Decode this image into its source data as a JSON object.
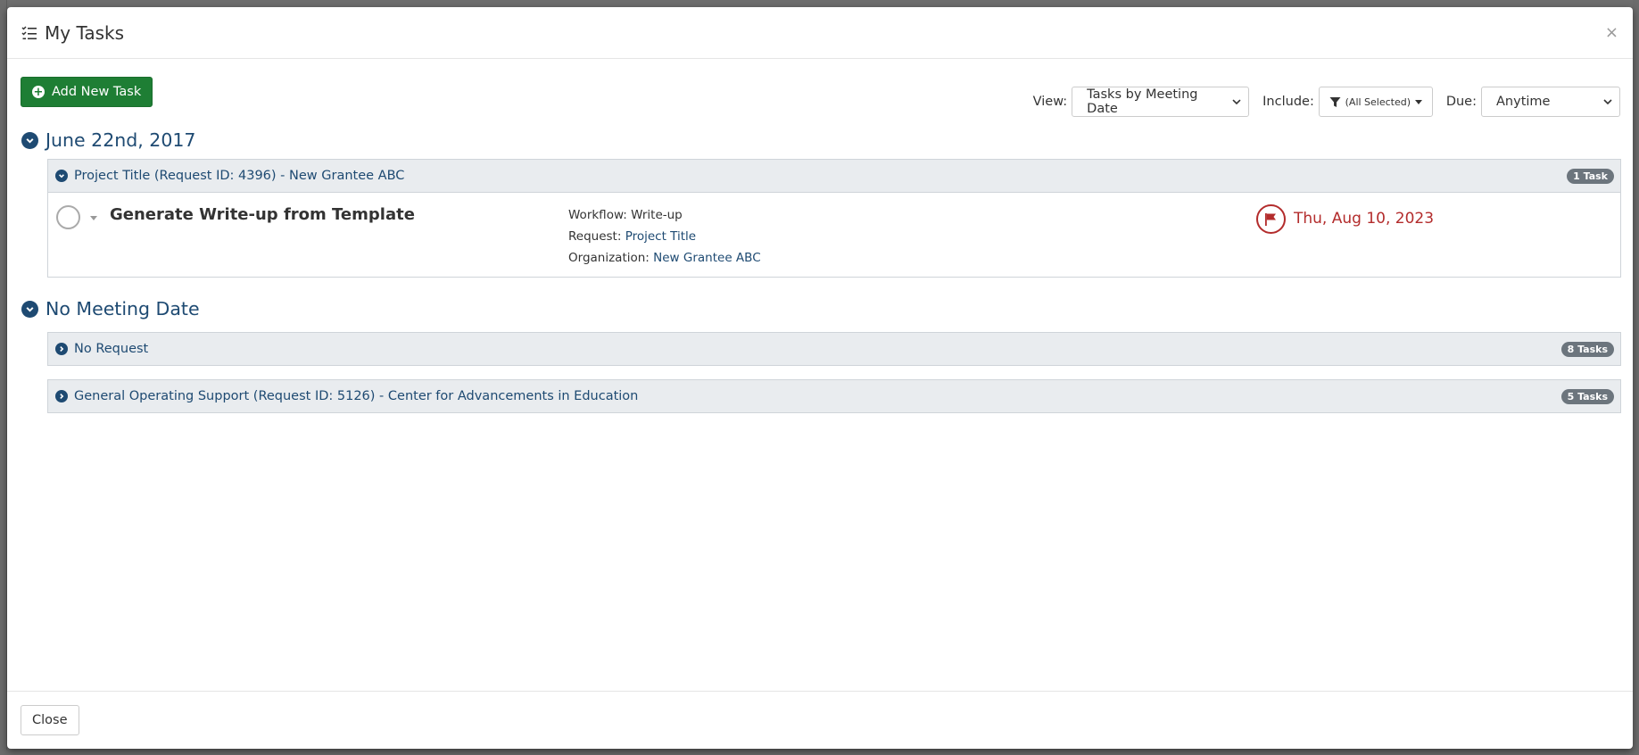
{
  "modal": {
    "title": "My Tasks",
    "close_symbol": "×"
  },
  "toolbar": {
    "add_button_label": "Add New Task",
    "add_icon": "plus-circle-icon",
    "view_label": "View:",
    "view_value": "Tasks by Meeting Date",
    "include_label": "Include:",
    "include_value": "(All Selected)",
    "due_label": "Due:",
    "due_value": "Anytime"
  },
  "groups": [
    {
      "heading": "June 22nd, 2017",
      "panels": [
        {
          "title": "Project Title (Request ID: 4396) - New Grantee ABC",
          "badge": "1 Task",
          "expanded": true,
          "tasks": [
            {
              "name": "Generate Write-up from Template",
              "workflow_label": "Workflow:",
              "workflow_value": "Write-up",
              "request_label": "Request:",
              "request_value": "Project Title",
              "organization_label": "Organization:",
              "organization_value": "New Grantee ABC",
              "due_date": "Thu, Aug 10, 2023"
            }
          ]
        }
      ]
    },
    {
      "heading": "No Meeting Date",
      "panels": [
        {
          "title": "No Request",
          "badge": "8 Tasks",
          "expanded": false
        },
        {
          "title": "General Operating Support (Request ID: 5126) - Center for Advancements in Education",
          "badge": "5 Tasks",
          "expanded": false
        }
      ]
    }
  ],
  "footer": {
    "close_label": "Close"
  },
  "colors": {
    "accent_navy": "#1e4a72",
    "success_green": "#1e7e34",
    "danger_red": "#b32c2c",
    "badge_gray": "#6c757d"
  }
}
